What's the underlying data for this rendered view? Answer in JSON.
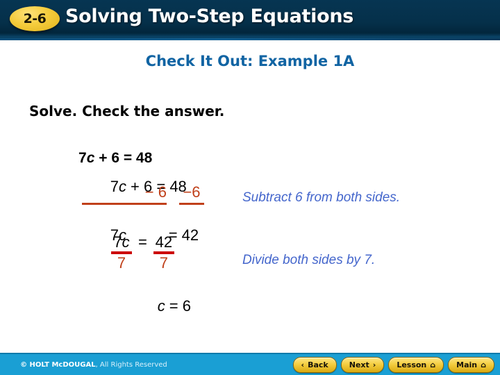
{
  "header": {
    "badge": "2-6",
    "title": "Solving Two-Step Equations"
  },
  "subtitle": "Check It Out: Example 1A",
  "prompt": "Solve. Check the answer.",
  "work": {
    "given": "7c + 6 = 48",
    "step1": "7c + 6 = 48",
    "step2_left": "− 6",
    "step2_right": "−6",
    "step3_lhs": "7c",
    "step3_rhs": "= 42",
    "step4": {
      "left_num": "7c",
      "left_den": "7",
      "equals": "=",
      "right_num": "42",
      "right_den": "7"
    },
    "step5": "c = 6"
  },
  "notes": {
    "note1": "Subtract 6 from both sides.",
    "note2": "Divide both sides by 7."
  },
  "footer": {
    "copyright_strong": "© HOLT McDOUGAL",
    "copyright_light": ", All Rights Reserved",
    "buttons": [
      {
        "label": "Back",
        "glyph": "‹",
        "glyph_side": "left",
        "home": ""
      },
      {
        "label": "Next",
        "glyph": "›",
        "glyph_side": "right",
        "home": ""
      },
      {
        "label": "Lesson",
        "glyph": "",
        "glyph_side": "right",
        "home": "⌂"
      },
      {
        "label": "Main",
        "glyph": "",
        "glyph_side": "right",
        "home": "⌂"
      }
    ]
  },
  "colors": {
    "header_bg": "#05304a",
    "badge": "#f5cc3c",
    "subtitle": "#1164a3",
    "annotation": "#4466cc",
    "subtract": "#c0401a",
    "frac_bar": "#cc0000",
    "footer_bg": "#1a9fd4"
  }
}
